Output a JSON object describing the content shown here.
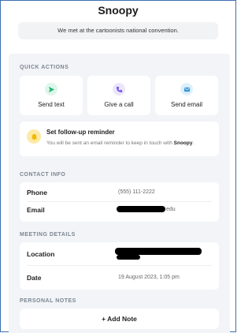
{
  "header": {
    "title": "Snoopy"
  },
  "note": "We met at the cartoonists national convention.",
  "quick_actions": {
    "section_label": "QUICK ACTIONS",
    "items": [
      {
        "label": "Send text",
        "icon": "send-icon",
        "color": "#2bb673",
        "bg": "#def6ec"
      },
      {
        "label": "Give a call",
        "icon": "phone-icon",
        "color": "#7b5ce6",
        "bg": "#ebe6fb"
      },
      {
        "label": "Send email",
        "icon": "mail-icon",
        "color": "#3a98d8",
        "bg": "#dff0fb"
      }
    ],
    "reminder": {
      "title": "Set follow-up reminder",
      "subtitle_prefix": "You will be sent an email reminder to keep in touch with",
      "subtitle_name": "Snoopy",
      "subtitle_suffix": ".",
      "icon": "bell-icon"
    }
  },
  "contact_info": {
    "section_label": "CONTACT INFO",
    "phone_label": "Phone",
    "phone_value": "(555) 111-2222",
    "email_label": "Email",
    "email_value_suffix": "edu"
  },
  "meeting_details": {
    "section_label": "MEETING DETAILS",
    "location_label": "Location",
    "date_label": "Date",
    "date_value": "19 August 2023, 1:05 pm"
  },
  "personal_notes": {
    "section_label": "PERSONAL NOTES",
    "add_note_icon": "+",
    "add_note_label": "Add Note"
  }
}
